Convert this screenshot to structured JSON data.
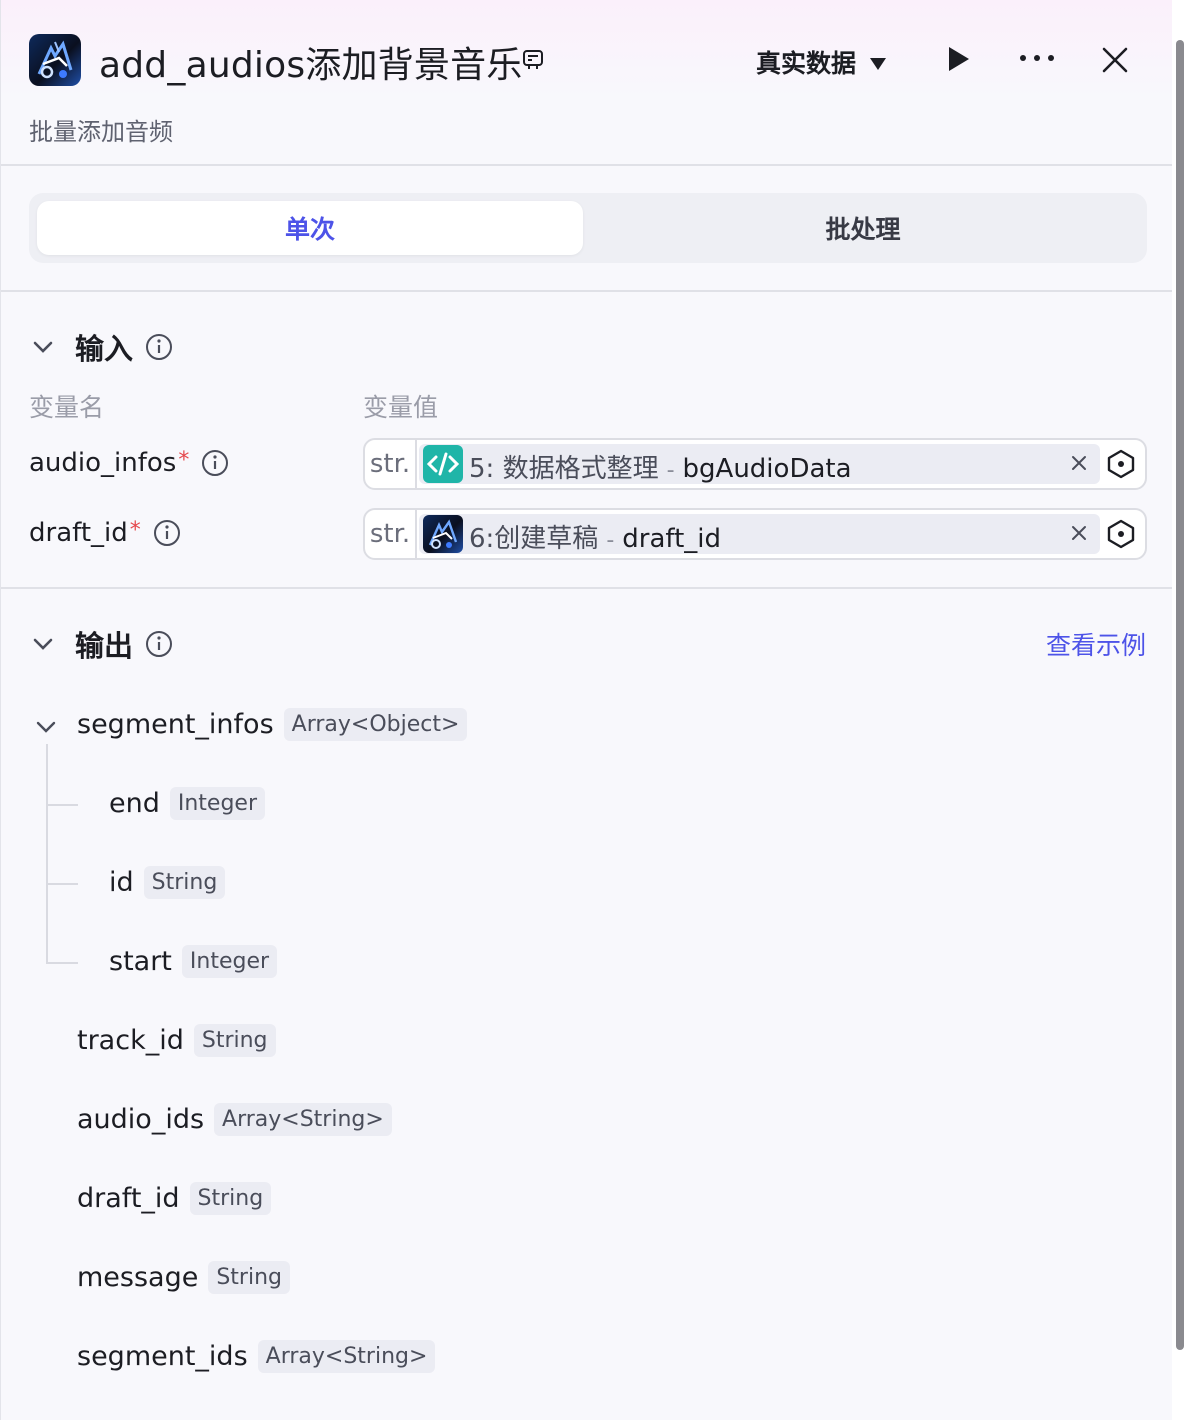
{
  "header": {
    "title": "add_audios添加背景音乐",
    "subtitle": "批量添加音频",
    "data_mode": "真实数据",
    "icons": {
      "app": "capcut-app-icon",
      "title_aux": "plugin-icon",
      "data_mode_caret": "caret-down-icon",
      "run": "play-icon",
      "more": "more-dots-icon",
      "close": "close-icon"
    }
  },
  "mode_tabs": {
    "single": "单次",
    "batch": "批处理",
    "active": "single"
  },
  "input": {
    "title": "输入",
    "col_name": "变量名",
    "col_value": "变量值",
    "rows": [
      {
        "name": "audio_infos",
        "required_mark": "*",
        "type": "str.",
        "node_icon": "code-node-icon",
        "node": "5:  数据格式整理",
        "separator": "-",
        "field": "bgAudioData"
      },
      {
        "name": "draft_id",
        "required_mark": "*",
        "type": "str.",
        "node_icon": "capcut-node-icon",
        "node": "6:创建草稿",
        "separator": "-",
        "field": "draft_id"
      }
    ]
  },
  "output": {
    "title": "输出",
    "view_example": "查看示例",
    "items": [
      {
        "name": "segment_infos",
        "type": "Array<Object>"
      },
      {
        "name": "end",
        "type": "Integer"
      },
      {
        "name": "id",
        "type": "String"
      },
      {
        "name": "start",
        "type": "Integer"
      },
      {
        "name": "track_id",
        "type": "String"
      },
      {
        "name": "audio_ids",
        "type": "Array<String>"
      },
      {
        "name": "draft_id",
        "type": "String"
      },
      {
        "name": "message",
        "type": "String"
      },
      {
        "name": "segment_ids",
        "type": "Array<String>"
      }
    ]
  },
  "colors": {
    "accent": "#4d53e8",
    "required": "#e5484d",
    "code_node": "#1fb5a8"
  }
}
